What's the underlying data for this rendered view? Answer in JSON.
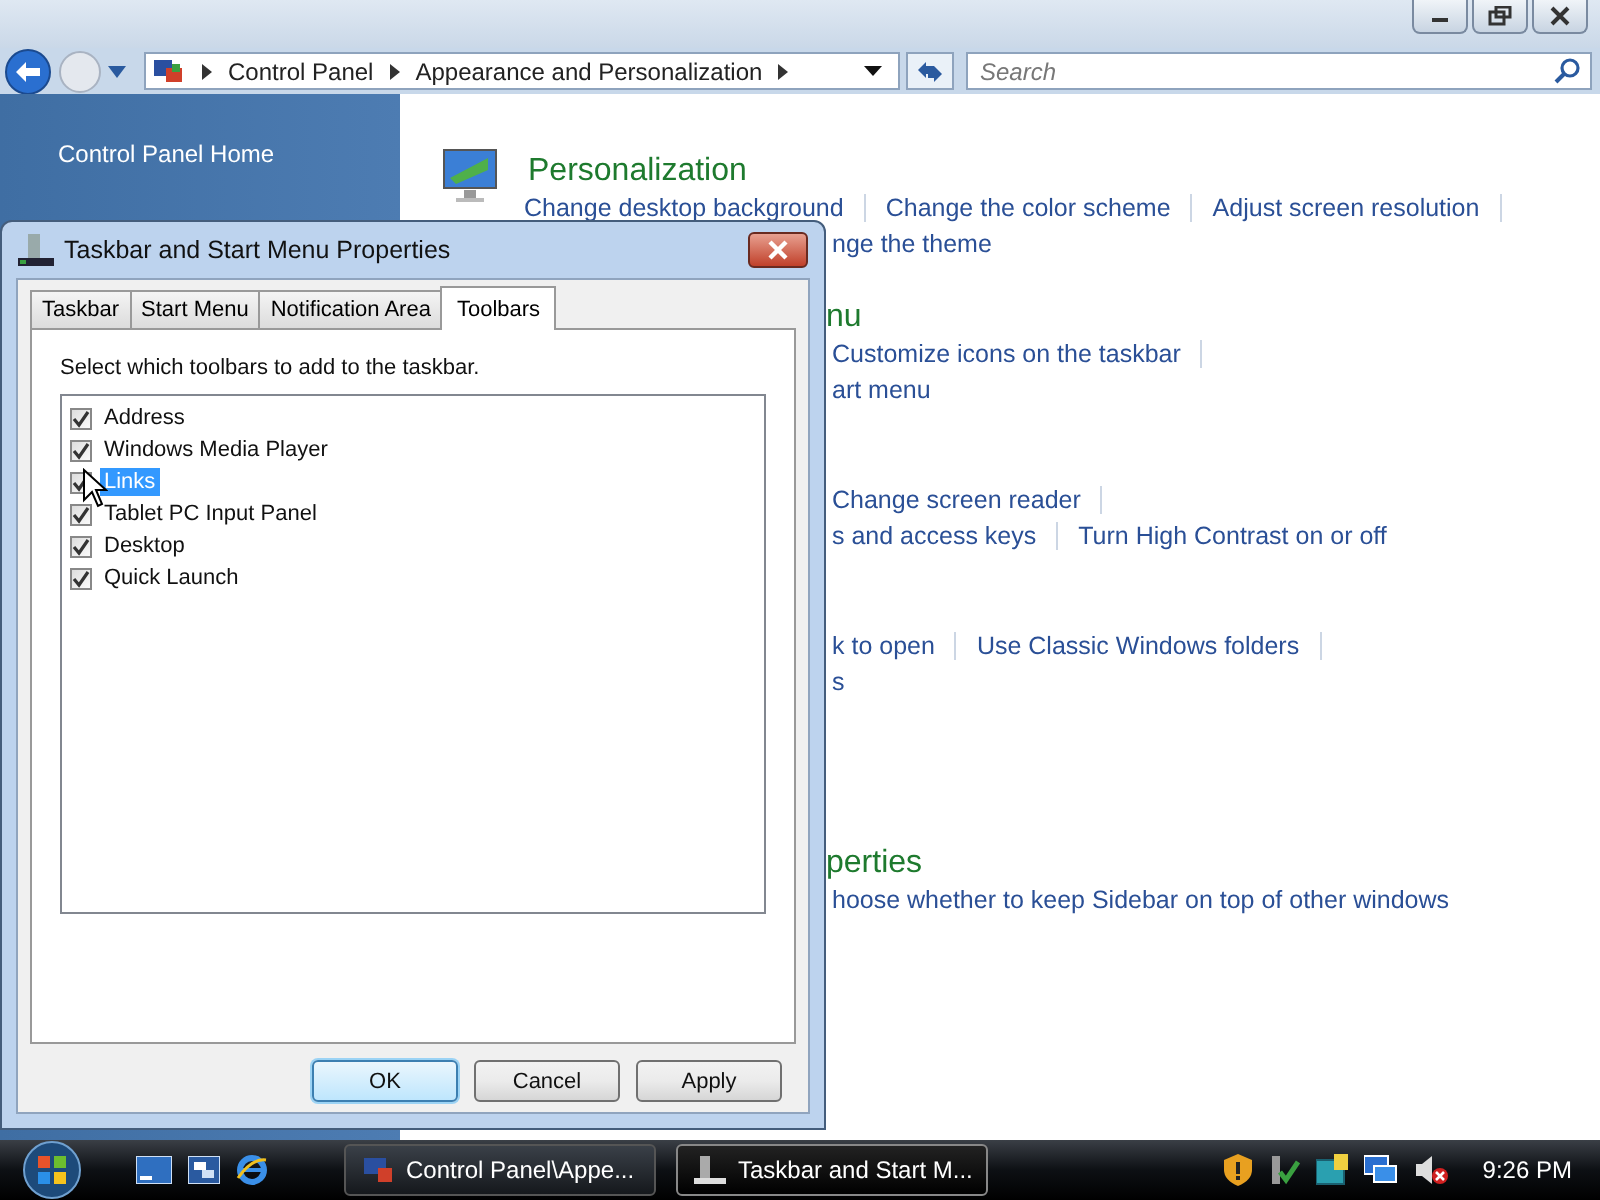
{
  "address_bar": {
    "breadcrumbs": [
      "Control Panel",
      "Appearance and Personalization"
    ]
  },
  "search": {
    "placeholder": "Search"
  },
  "sidebar": {
    "items": [
      {
        "label": "Control Panel Home"
      }
    ]
  },
  "content": {
    "sections": [
      {
        "heading": "Personalization",
        "clipped": false,
        "rows": [
          {
            "clipped": false,
            "links": [
              {
                "text": "Change desktop background",
                "divider": true
              },
              {
                "text": "Change the color scheme",
                "divider": true
              },
              {
                "text": "Adjust screen resolution",
                "divider": true
              }
            ]
          },
          {
            "clipped": true,
            "links": [
              {
                "text": "nge the theme",
                "divider": false
              }
            ]
          }
        ]
      },
      {
        "heading": "nu",
        "clipped": true,
        "rows": [
          {
            "clipped": true,
            "links": [
              {
                "text": "Customize icons on the taskbar",
                "divider": true
              }
            ]
          },
          {
            "clipped": true,
            "links": [
              {
                "text": "art menu",
                "divider": false
              }
            ]
          }
        ]
      },
      {
        "rows": [
          {
            "clipped": true,
            "links": [
              {
                "text": "Change screen reader",
                "divider": true
              }
            ]
          },
          {
            "clipped": true,
            "links": [
              {
                "text": "s and access keys",
                "divider": true
              },
              {
                "text": "Turn High Contrast on or off",
                "divider": false
              }
            ]
          }
        ]
      },
      {
        "rows": [
          {
            "clipped": true,
            "links": [
              {
                "text": "k to open",
                "divider": true
              },
              {
                "text": "Use Classic Windows folders",
                "divider": true
              }
            ]
          },
          {
            "clipped": true,
            "links": [
              {
                "text": "s",
                "divider": false
              }
            ]
          }
        ]
      },
      {
        "heading": "perties",
        "clipped": true,
        "rows": [
          {
            "clipped": true,
            "links": [
              {
                "text": "hoose whether to keep Sidebar on top of other windows",
                "divider": false
              }
            ]
          }
        ]
      }
    ]
  },
  "dialog": {
    "title": "Taskbar and Start Menu Properties",
    "tabs": [
      {
        "label": "Taskbar",
        "selected": false
      },
      {
        "label": "Start Menu",
        "selected": false
      },
      {
        "label": "Notification Area",
        "selected": false
      },
      {
        "label": "Toolbars",
        "selected": true
      }
    ],
    "instruction": "Select which toolbars to add to the taskbar.",
    "toolbars": [
      {
        "label": "Address",
        "checked": true,
        "selected": false
      },
      {
        "label": "Windows Media Player",
        "checked": true,
        "selected": false
      },
      {
        "label": "Links",
        "checked": true,
        "selected": true
      },
      {
        "label": "Tablet PC Input Panel",
        "checked": true,
        "selected": false
      },
      {
        "label": "Desktop",
        "checked": true,
        "selected": false
      },
      {
        "label": "Quick Launch",
        "checked": true,
        "selected": false
      }
    ],
    "buttons": [
      {
        "label": "OK",
        "default": true
      },
      {
        "label": "Cancel",
        "default": false
      },
      {
        "label": "Apply",
        "default": false
      }
    ]
  },
  "taskbar": {
    "tasks": [
      {
        "label": "Control Panel\\Appe...",
        "active": false
      },
      {
        "label": "Taskbar and Start M...",
        "active": true
      }
    ],
    "clock": "9:26 PM"
  }
}
